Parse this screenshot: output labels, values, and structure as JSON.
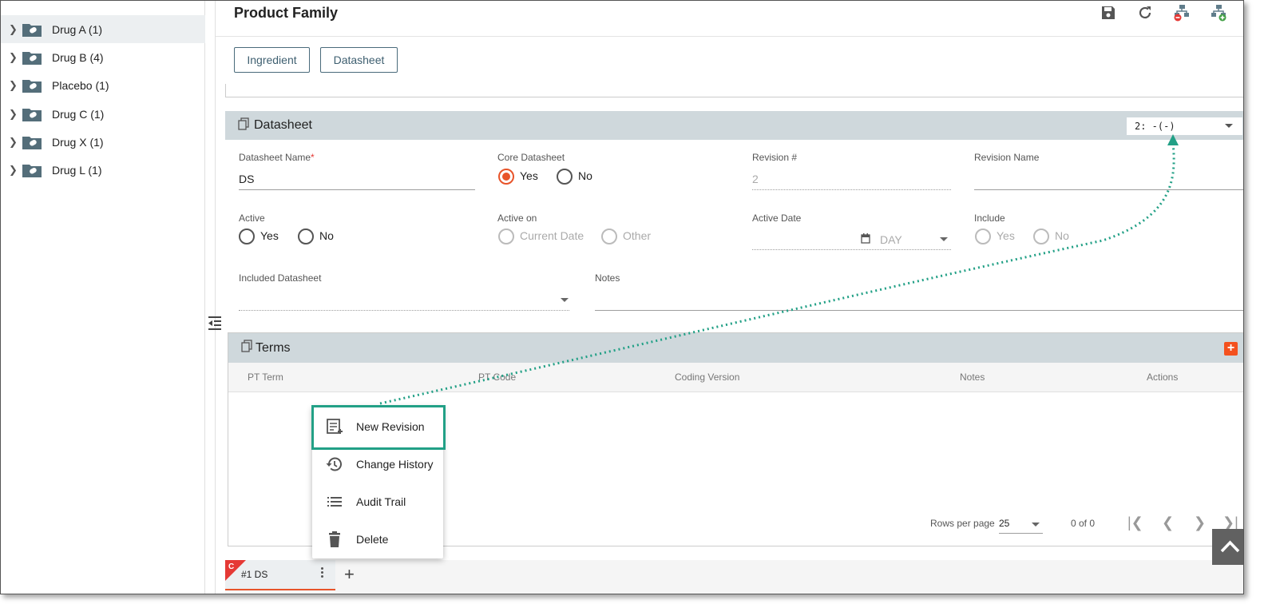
{
  "sidebar": {
    "items": [
      {
        "label": "Drug A (1)",
        "selected": true
      },
      {
        "label": "Drug B (4)",
        "selected": false
      },
      {
        "label": "Placebo (1)",
        "selected": false
      },
      {
        "label": "Drug C (1)",
        "selected": false
      },
      {
        "label": "Drug X (1)",
        "selected": false
      },
      {
        "label": "Drug L (1)",
        "selected": false
      }
    ]
  },
  "header": {
    "title": "Product Family",
    "icons": [
      "save-icon",
      "refresh-icon",
      "hierarchy-remove-icon",
      "hierarchy-add-icon"
    ]
  },
  "tabs": [
    "Ingredient",
    "Datasheet"
  ],
  "datasheet": {
    "title": "Datasheet",
    "revision_select": "2: -(-)",
    "name_label": "Datasheet Name",
    "name_required": "*",
    "name_value": "DS",
    "core_label": "Core Datasheet",
    "core_yes": "Yes",
    "core_no": "No",
    "revision_num_label": "Revision #",
    "revision_num_value": "2",
    "revision_name_label": "Revision Name",
    "active_label": "Active",
    "active_yes": "Yes",
    "active_no": "No",
    "active_on_label": "Active on",
    "active_on_current": "Current Date",
    "active_on_other": "Other",
    "active_date_label": "Active Date",
    "active_date_unit": "DAY",
    "include_label": "Include",
    "include_yes": "Yes",
    "include_no": "No",
    "included_ds_label": "Included Datasheet",
    "notes_label": "Notes"
  },
  "terms": {
    "title": "Terms",
    "columns": [
      "PT Term",
      "PT Code",
      "Coding Version",
      "Notes",
      "Actions"
    ],
    "rows_per_page_label": "Rows per page",
    "rows_per_page": "25",
    "range": "0 of 0"
  },
  "bottom_tab": {
    "badge": "C",
    "label": "#1 DS"
  },
  "context_menu": {
    "items": [
      "New Revision",
      "Change History",
      "Audit Trail",
      "Delete"
    ]
  },
  "colors": {
    "accent": "#e8542a",
    "panel_header": "#cfd8dc",
    "callout": "#22a086"
  }
}
